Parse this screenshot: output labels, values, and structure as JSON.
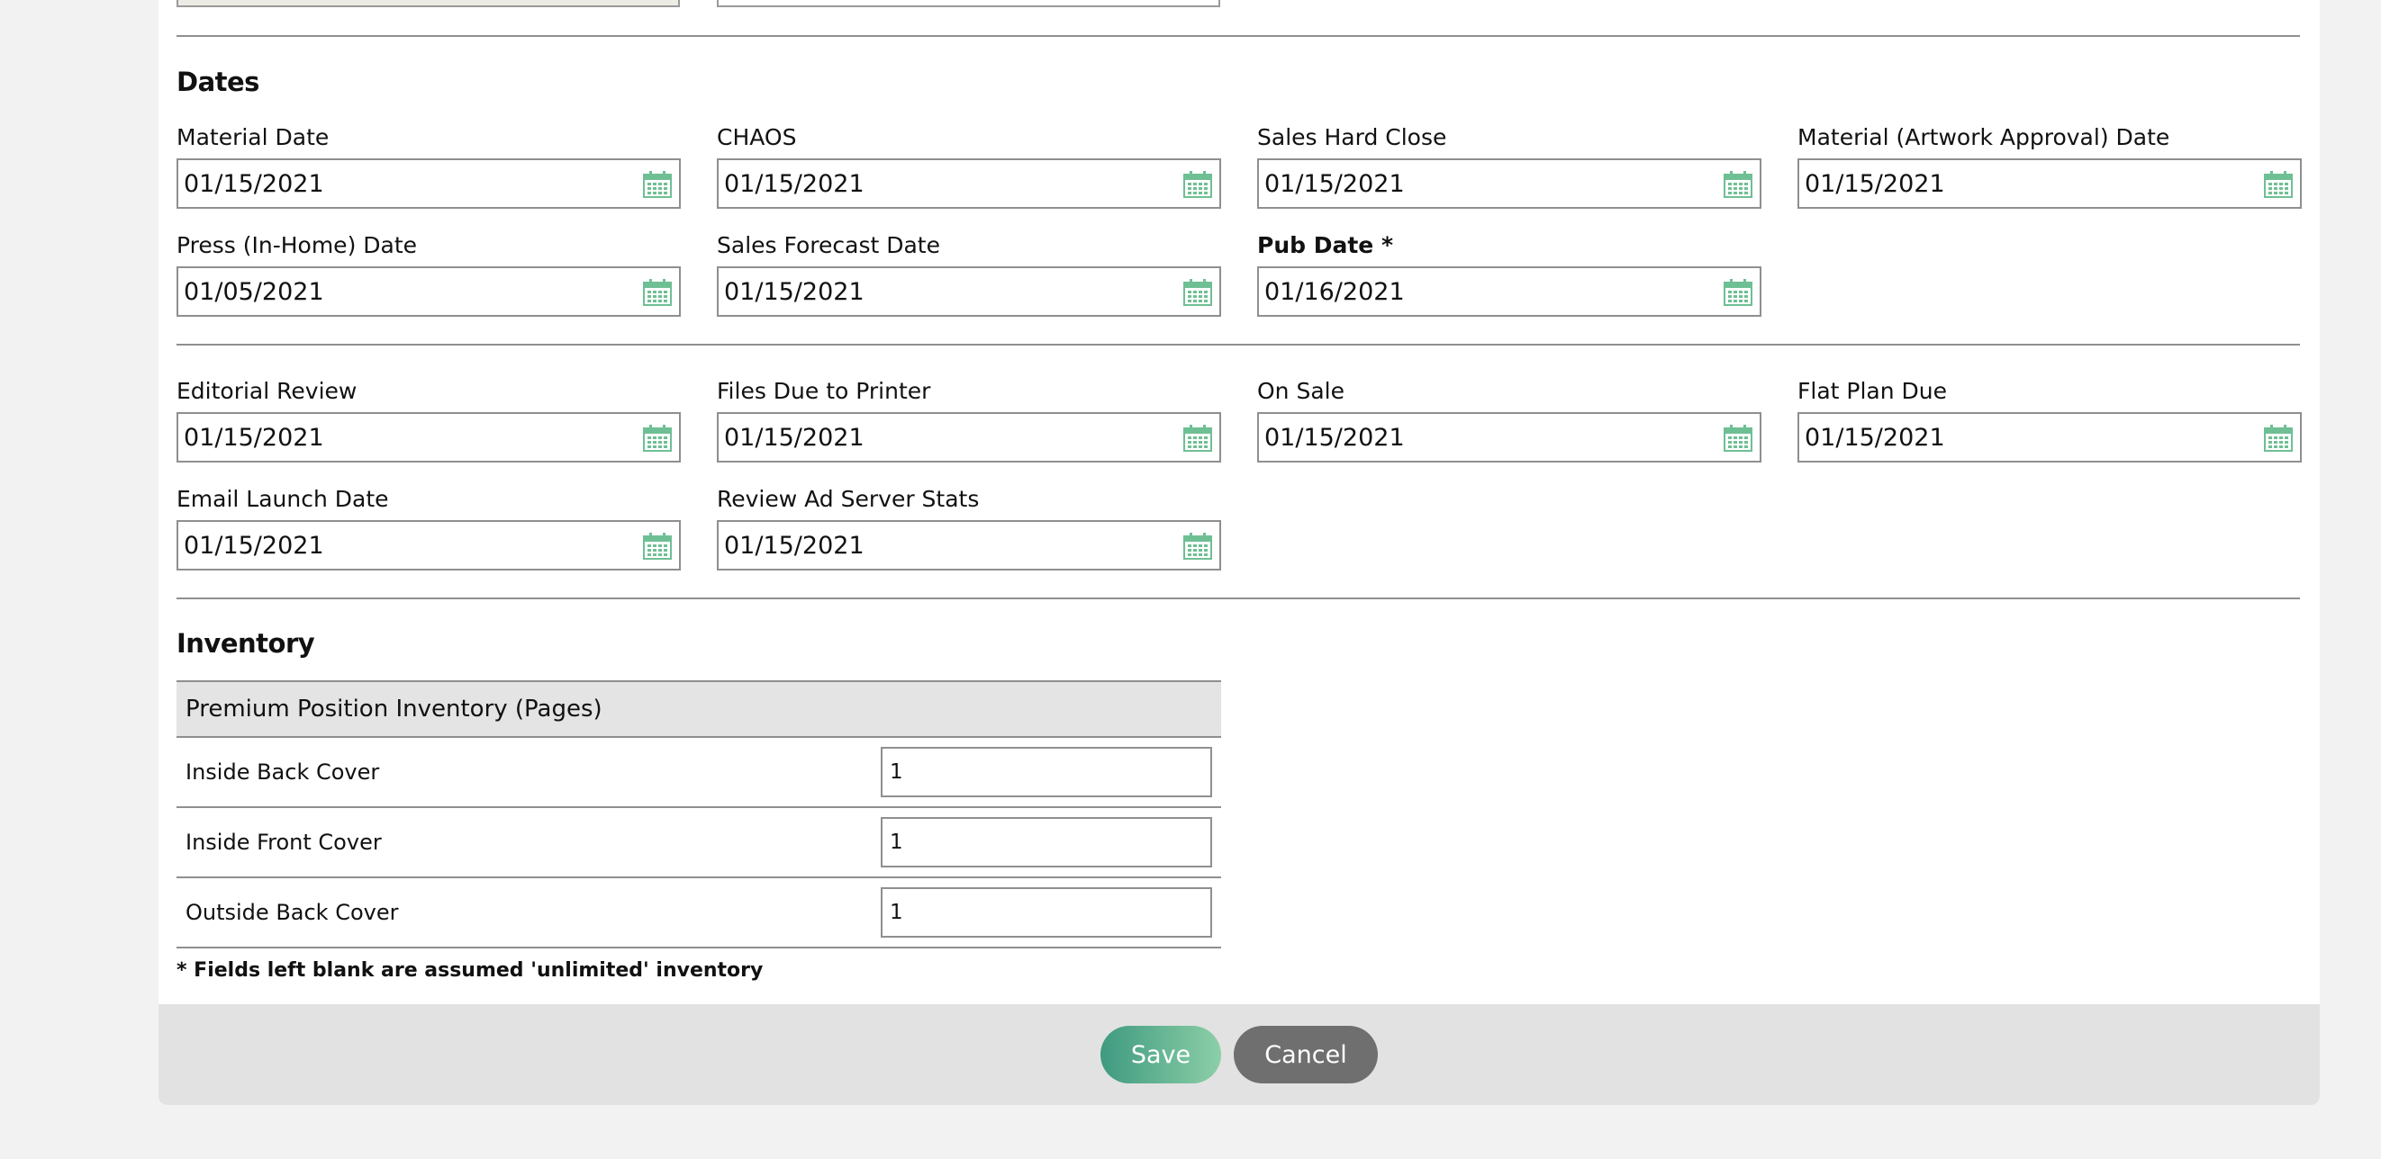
{
  "sections": {
    "dates_title": "Dates",
    "inventory_title": "Inventory"
  },
  "dates": {
    "material_date": {
      "label": "Material Date",
      "value": "01/15/2021"
    },
    "chaos": {
      "label": "CHAOS",
      "value": "01/15/2021"
    },
    "sales_hard_close": {
      "label": "Sales Hard Close",
      "value": "01/15/2021"
    },
    "material_artwork": {
      "label": "Material (Artwork Approval) Date",
      "value": "01/15/2021"
    },
    "press_in_home": {
      "label": "Press (In-Home) Date",
      "value": "01/05/2021"
    },
    "sales_forecast": {
      "label": "Sales Forecast Date",
      "value": "01/15/2021"
    },
    "pub_date": {
      "label": "Pub Date *",
      "value": "01/16/2021"
    },
    "editorial_review": {
      "label": "Editorial Review",
      "value": "01/15/2021"
    },
    "files_due_printer": {
      "label": "Files Due to Printer",
      "value": "01/15/2021"
    },
    "on_sale": {
      "label": "On Sale",
      "value": "01/15/2021"
    },
    "flat_plan_due": {
      "label": "Flat Plan Due",
      "value": "01/15/2021"
    },
    "email_launch": {
      "label": "Email Launch Date",
      "value": "01/15/2021"
    },
    "review_ad_server": {
      "label": "Review Ad Server Stats",
      "value": "01/15/2021"
    }
  },
  "inventory": {
    "header": "Premium Position Inventory (Pages)",
    "rows": [
      {
        "label": "Inside Back Cover",
        "value": "1"
      },
      {
        "label": "Inside Front Cover",
        "value": "1"
      },
      {
        "label": "Outside Back Cover",
        "value": "1"
      }
    ],
    "note": "* Fields left blank are assumed 'unlimited' inventory"
  },
  "footer": {
    "save_label": "Save",
    "cancel_label": "Cancel"
  },
  "colors": {
    "accent": "#3f9a80",
    "calendar_icon": "#6fbf94",
    "cancel": "#6f6f6f"
  },
  "icons": {
    "date_picker": "calendar-icon"
  }
}
